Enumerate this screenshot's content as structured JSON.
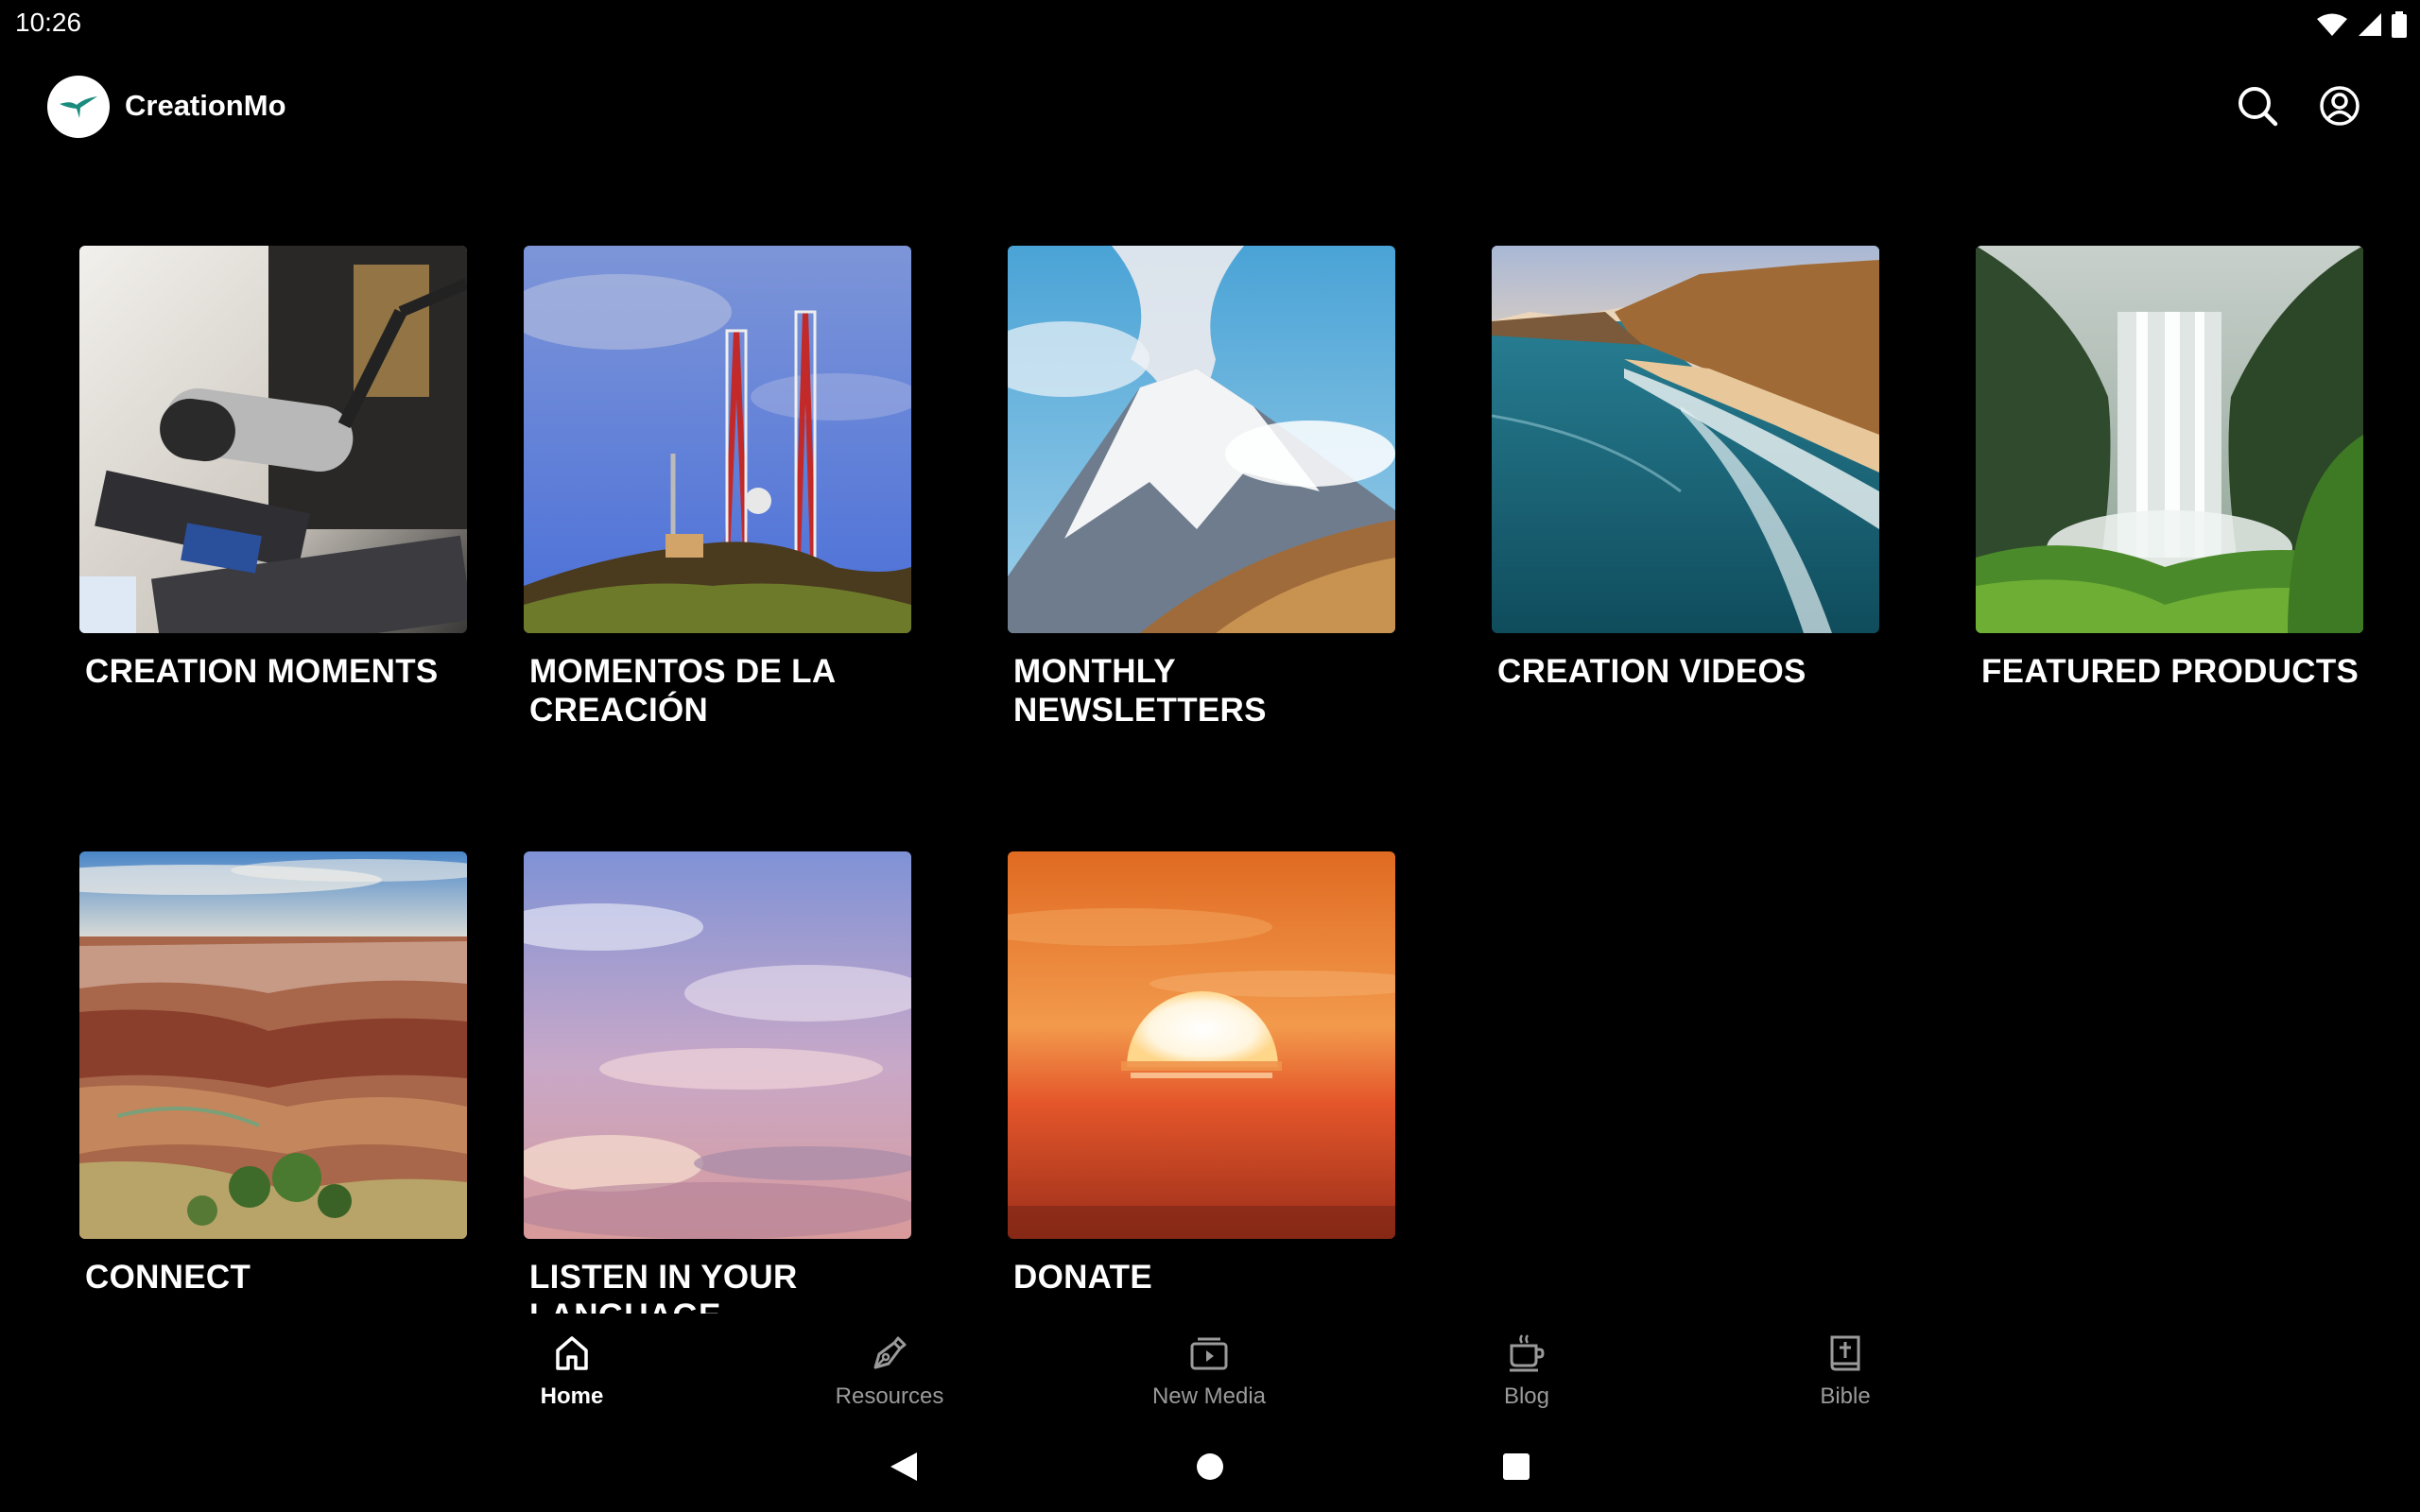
{
  "status_bar": {
    "time": "10:26",
    "icons": [
      "wifi-icon",
      "signal-icon",
      "battery-icon"
    ]
  },
  "app_bar": {
    "title": "CreationMo",
    "logo_icon": "bird-logo-icon",
    "actions": [
      "search-icon",
      "account-icon"
    ]
  },
  "tiles": [
    {
      "label": "CREATION MOMENTS",
      "image": "radio-studio-microphone"
    },
    {
      "label": "MOMENTOS DE LA CREACIÓN",
      "image": "radio-towers"
    },
    {
      "label": "MONTHLY NEWSLETTERS",
      "image": "snowy-mountain"
    },
    {
      "label": "CREATION VIDEOS",
      "image": "ocean-coastline"
    },
    {
      "label": "FEATURED PRODUCTS",
      "image": "waterfall-forest"
    },
    {
      "label": "CONNECT",
      "image": "grand-canyon"
    },
    {
      "label": "LISTEN IN YOUR LANGUAGE",
      "image": "pastel-sky"
    },
    {
      "label": "DONATE",
      "image": "orange-sunset"
    }
  ],
  "bottom_nav": {
    "active": "Home",
    "items": [
      {
        "label": "Home",
        "icon": "home-icon"
      },
      {
        "label": "Resources",
        "icon": "pen-icon"
      },
      {
        "label": "New Media",
        "icon": "media-icon"
      },
      {
        "label": "Blog",
        "icon": "coffee-cup-icon"
      },
      {
        "label": "Bible",
        "icon": "bible-icon"
      }
    ]
  },
  "system_nav": [
    "back-icon",
    "home-circle-icon",
    "recents-icon"
  ],
  "colors": {
    "background": "#000000",
    "text": "#ffffff",
    "nav_inactive": "#9a9a9a",
    "logo_accent": "#1a8c7e"
  }
}
